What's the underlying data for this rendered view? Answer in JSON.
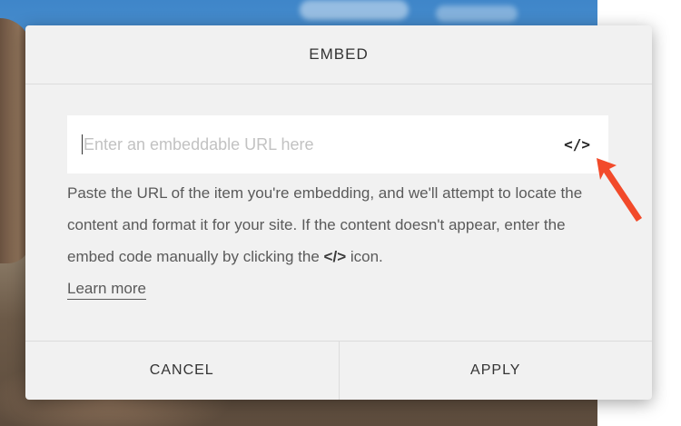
{
  "dialog": {
    "title": "EMBED",
    "url_input": {
      "placeholder": "Enter an embeddable URL here",
      "value": ""
    },
    "code_button_label": "</>",
    "help": {
      "text_part1": "Paste the URL of the item you're embedding, and we'll attempt to locate the content and format it for your site. If the content doesn't appear, enter the embed code manually by clicking the ",
      "code_glyph": "</>",
      "text_part2": " icon.",
      "learn_more_label": "Learn more"
    },
    "buttons": {
      "cancel_label": "CANCEL",
      "apply_label": "APPLY"
    }
  },
  "icons": {
    "code": "code-icon",
    "annotation_arrow": "arrow-icon"
  },
  "colors": {
    "dialog_bg": "#f1f1f1",
    "input_bg": "#ffffff",
    "arrow": "#f24a2a",
    "placeholder": "#c2c2c2"
  }
}
